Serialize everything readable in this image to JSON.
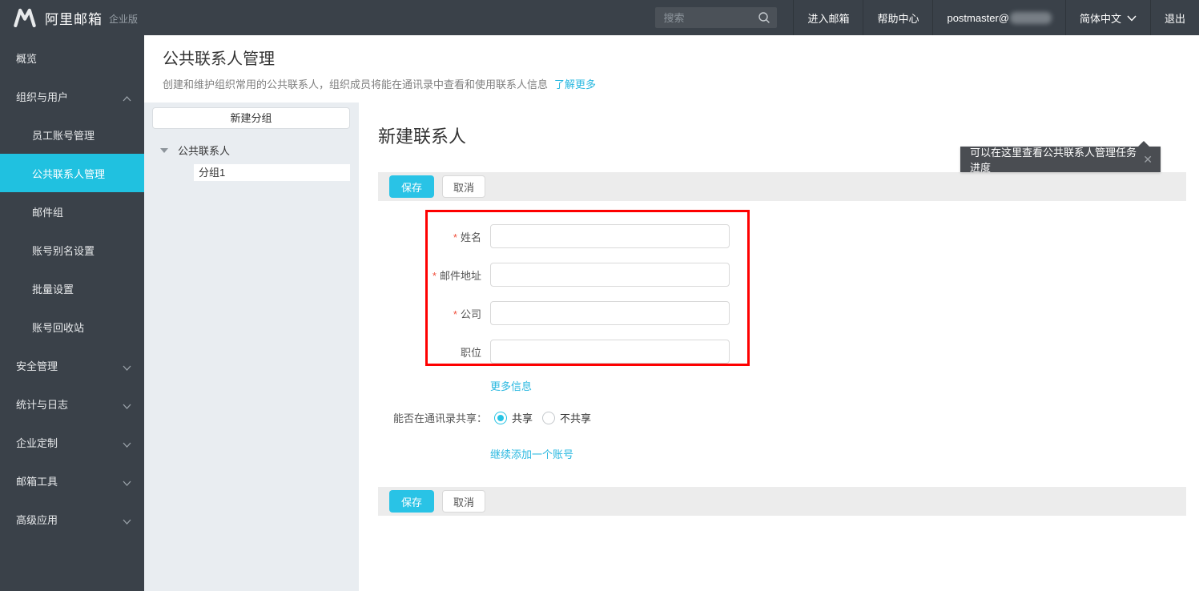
{
  "topbar": {
    "brand": {
      "name": "阿里邮箱",
      "edition": "企业版"
    },
    "search": {
      "placeholder": "搜索"
    },
    "menu": {
      "enter_mail": "进入邮箱",
      "help_center": "帮助中心",
      "account": "postmaster@",
      "language": "简体中文",
      "logout": "退出"
    }
  },
  "sidebar": {
    "items": [
      {
        "label": "概览"
      },
      {
        "label": "组织与用户"
      },
      {
        "label": "员工账号管理"
      },
      {
        "label": "公共联系人管理"
      },
      {
        "label": "邮件组"
      },
      {
        "label": "账号别名设置"
      },
      {
        "label": "批量设置"
      },
      {
        "label": "账号回收站"
      },
      {
        "label": "安全管理"
      },
      {
        "label": "统计与日志"
      },
      {
        "label": "企业定制"
      },
      {
        "label": "邮箱工具"
      },
      {
        "label": "高级应用"
      }
    ]
  },
  "group_panel": {
    "new_group_button": "新建分组",
    "tree_root": "公共联系人",
    "tree_child": "分组1"
  },
  "header": {
    "title": "公共联系人管理",
    "description": "创建和维护组织常用的公共联系人，组织成员将能在通讯录中查看和使用联系人信息",
    "learn_more": "了解更多"
  },
  "main": {
    "title": "新建联系人",
    "tooltip": {
      "text": "可以在这里查看公共联系人管理任务进度",
      "close_icon": "✕"
    },
    "toolbar": {
      "save": "保存",
      "cancel": "取消"
    },
    "form": {
      "required_marker": "*",
      "fields": [
        {
          "label": "姓名",
          "required": true,
          "value": ""
        },
        {
          "label": "邮件地址",
          "required": true,
          "value": ""
        },
        {
          "label": "公司",
          "required": true,
          "value": ""
        },
        {
          "label": "职位",
          "required": false,
          "value": ""
        }
      ],
      "more_info_link": "更多信息",
      "share_label": "能否在通讯录共享：",
      "share_options": [
        {
          "label": "共享",
          "selected": true
        },
        {
          "label": "不共享",
          "selected": false
        }
      ],
      "add_another_link": "继续添加一个账号"
    }
  },
  "colors": {
    "topbar_bg": "#3a4149",
    "accent": "#26c3e4",
    "link": "#29b8e0",
    "annotation_red": "#fe0000",
    "required_red": "#f0503c",
    "panel_gray": "#e9edf1"
  }
}
